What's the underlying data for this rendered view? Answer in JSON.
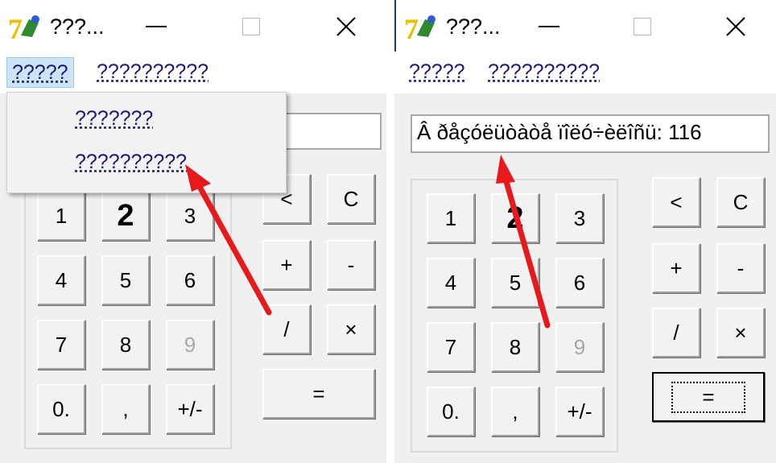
{
  "window_left": {
    "title": "???...",
    "menu": [
      "?????",
      "??????????"
    ],
    "dropdown_items": [
      "???????",
      "??????????"
    ],
    "display_value": "",
    "digits": [
      "1",
      "2",
      "3",
      "4",
      "5",
      "6",
      "7",
      "8",
      "9",
      "0.",
      ",",
      "+/-"
    ],
    "ops": [
      "<",
      "C",
      "+",
      "-",
      "/",
      "×",
      "="
    ]
  },
  "window_right": {
    "title": "???...",
    "menu": [
      "?????",
      "??????????"
    ],
    "display_value": "Â ðåçóëüòàòå ïîëó÷èëîñü: 116",
    "digits": [
      "1",
      "2",
      "3",
      "4",
      "5",
      "6",
      "7",
      "8",
      "9",
      "0.",
      ",",
      "+/-"
    ],
    "ops": [
      "<",
      "C",
      "+",
      "-",
      "/",
      "×",
      "="
    ]
  },
  "colors": {
    "annotation_arrow": "#e8191a",
    "menu_highlight": "#cce4f7"
  },
  "icons": {
    "app": "app-icon",
    "minimize": "minimize-icon",
    "maximize": "maximize-icon",
    "close": "close-icon"
  }
}
